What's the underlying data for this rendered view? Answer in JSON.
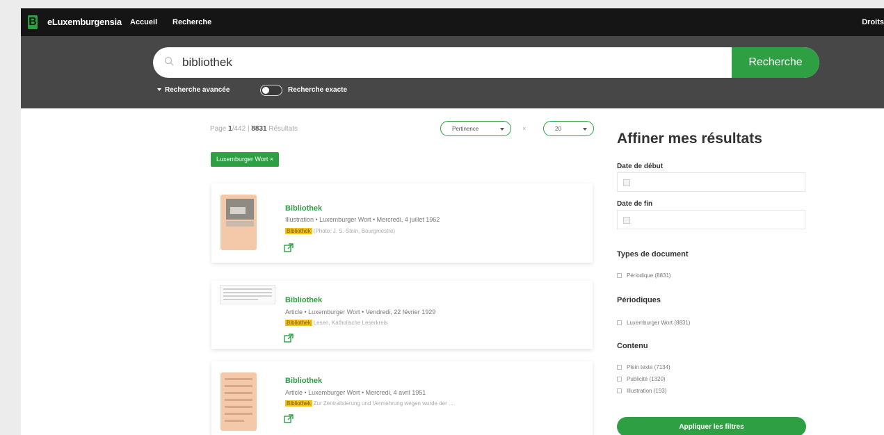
{
  "nav": {
    "logo_letter": "B",
    "brand": "eLuxemburgensia",
    "items": [
      "Accueil",
      "Recherche"
    ],
    "right": "Droits"
  },
  "search": {
    "value": "bibliothek",
    "button": "Recherche",
    "advanced": "Recherche avancée",
    "exact": "Recherche exacte",
    "exact_on": false
  },
  "results_header": {
    "page_label": "Page",
    "page": "1",
    "total_pages": "/442 |",
    "count": "8831",
    "count_label": "Résultats",
    "sort": "Pertinence",
    "sep": "×",
    "per_page": "20"
  },
  "active_filter": "Luxemburger Wort ×",
  "results": [
    {
      "title": "Bibliothek",
      "meta": "Illustration • Luxemburger Wort • Mercredi, 4 juillet 1962",
      "highlight": "Bibliothek",
      "snippet": "(Photo: J. S. Stein, Bourgmestre)"
    },
    {
      "title": "Bibliothek",
      "meta": "Article • Luxemburger Wort • Vendredi, 22 février 1929",
      "highlight": "Bibliothek",
      "snippet": "Lesen, Katholische Leserkreis"
    },
    {
      "title": "Bibliothek",
      "meta": "Article • Luxemburger Wort • Mercredi, 4 avril 1951",
      "highlight": "Bibliothek",
      "snippet": "Zur Zentralisierung und Vermehrung wegen wurde der ..."
    }
  ],
  "sidebar": {
    "title": "Affiner mes résultats",
    "date_start": "Date de début",
    "date_end": "Date de fin",
    "types_title": "Types de document",
    "types": [
      "Périodique (8831)"
    ],
    "periodicals_title": "Périodiques",
    "periodicals": [
      "Luxemburger Wort (8831)"
    ],
    "content_title": "Contenu",
    "content": [
      "Plein texte (7134)",
      "Publicité (1320)",
      "Illustration (193)"
    ],
    "apply": "Appliquer les filtres"
  },
  "colors": {
    "accent": "#2ea043",
    "nav_bg": "#151515",
    "search_band": "#474747",
    "highlight": "#f0c419"
  }
}
